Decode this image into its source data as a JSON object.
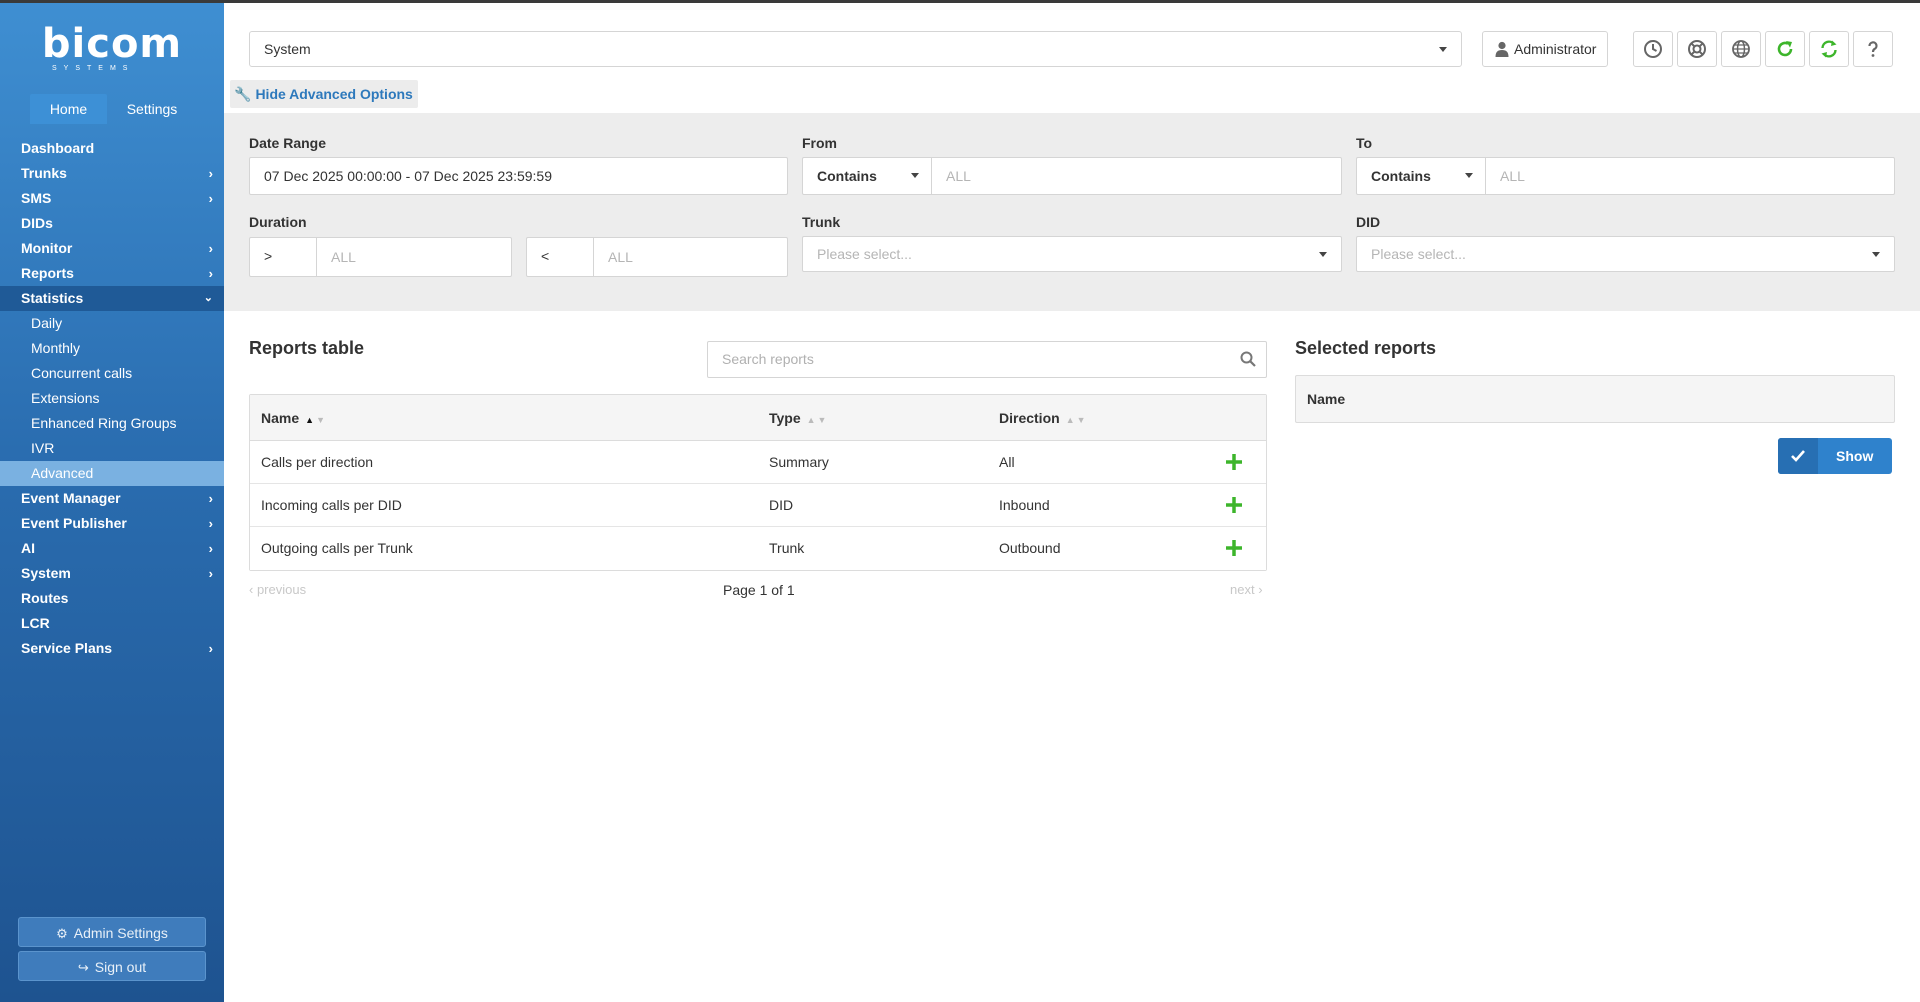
{
  "logo": {
    "main": "bicom",
    "sub": "SYSTEMS"
  },
  "nav_tabs": [
    "Home",
    "Settings"
  ],
  "menu": {
    "dashboard": "Dashboard",
    "trunks": "Trunks",
    "sms": "SMS",
    "dids": "DIDs",
    "monitor": "Monitor",
    "reports": "Reports",
    "statistics": "Statistics",
    "statistics_sub": [
      "Daily",
      "Monthly",
      "Concurrent calls",
      "Extensions",
      "Enhanced Ring Groups",
      "IVR",
      "Advanced"
    ],
    "event_manager": "Event Manager",
    "event_publisher": "Event Publisher",
    "ai": "AI",
    "system": "System",
    "routes": "Routes",
    "lcr": "LCR",
    "service_plans": "Service Plans"
  },
  "sidebar_buttons": {
    "admin_settings": "Admin Settings",
    "sign_out": "Sign out"
  },
  "topbar": {
    "tenant_select": "System",
    "user": "Administrator",
    "icons": [
      "clock-icon",
      "support-icon",
      "globe-icon",
      "refresh-icon",
      "sync-icon",
      "help-icon"
    ]
  },
  "advanced_toggle": "Hide Advanced Options",
  "filters": {
    "date_range": {
      "label": "Date Range",
      "value": "07 Dec 2025 00:00:00 - 07 Dec 2025 23:59:59"
    },
    "from": {
      "label": "From",
      "operator": "Contains",
      "placeholder": "ALL"
    },
    "to": {
      "label": "To",
      "operator": "Contains",
      "placeholder": "ALL"
    },
    "duration": {
      "label": "Duration",
      "op1": ">",
      "placeholder1": "ALL",
      "op2": "<",
      "placeholder2": "ALL"
    },
    "trunk": {
      "label": "Trunk",
      "placeholder": "Please select..."
    },
    "did": {
      "label": "DID",
      "placeholder": "Please select..."
    }
  },
  "reports_table": {
    "title": "Reports table",
    "search_placeholder": "Search reports",
    "columns": [
      "Name",
      "Type",
      "Direction"
    ],
    "rows": [
      {
        "name": "Calls per direction",
        "type": "Summary",
        "direction": "All"
      },
      {
        "name": "Incoming calls per DID",
        "type": "DID",
        "direction": "Inbound"
      },
      {
        "name": "Outgoing calls per Trunk",
        "type": "Trunk",
        "direction": "Outbound"
      }
    ],
    "pager": {
      "previous": "previous",
      "info": "Page 1 of 1",
      "next": "next"
    }
  },
  "selected_reports": {
    "title": "Selected reports",
    "column": "Name",
    "show_button": "Show"
  },
  "colors": {
    "accent": "#2f82cc",
    "add_green": "#3db52b",
    "sidebar_top": "#3f8fd2",
    "sidebar_bottom": "#1e5390"
  }
}
